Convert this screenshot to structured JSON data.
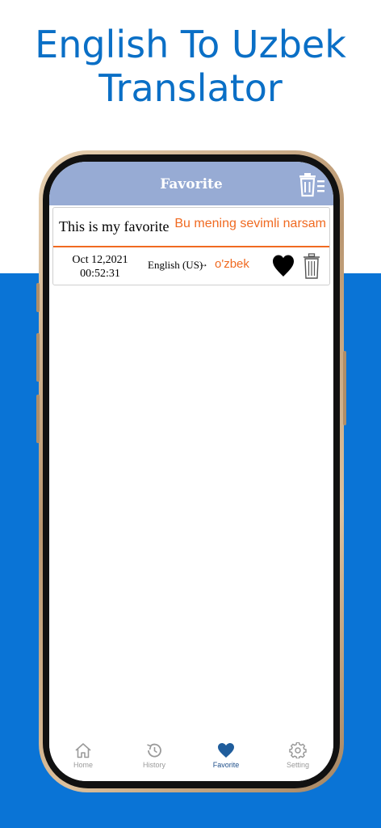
{
  "headline": {
    "line1": "English To Uzbek",
    "line2": "Translator"
  },
  "colors": {
    "brand_blue": "#0a74d6",
    "navbar": "#97abd4",
    "accent_orange": "#f06a21",
    "active_tab": "#1f4f8a"
  },
  "navbar": {
    "title": "Favorite",
    "clear_icon": "clear-all-trash-icon"
  },
  "favorites": [
    {
      "source_text": "This is my favorite",
      "translated_text": "Bu mening sevimli narsam",
      "date": "Oct 12,2021",
      "time": "00:52:31",
      "from_lang": "English (US)",
      "arrow": "→",
      "to_lang": "o'zbek",
      "favorited": true
    }
  ],
  "tabbar": {
    "tabs": [
      {
        "label": "Home",
        "icon": "home-icon"
      },
      {
        "label": "History",
        "icon": "history-icon"
      },
      {
        "label": "Favorite",
        "icon": "heart-icon",
        "active": true
      },
      {
        "label": "Setting",
        "icon": "gear-icon"
      }
    ]
  }
}
